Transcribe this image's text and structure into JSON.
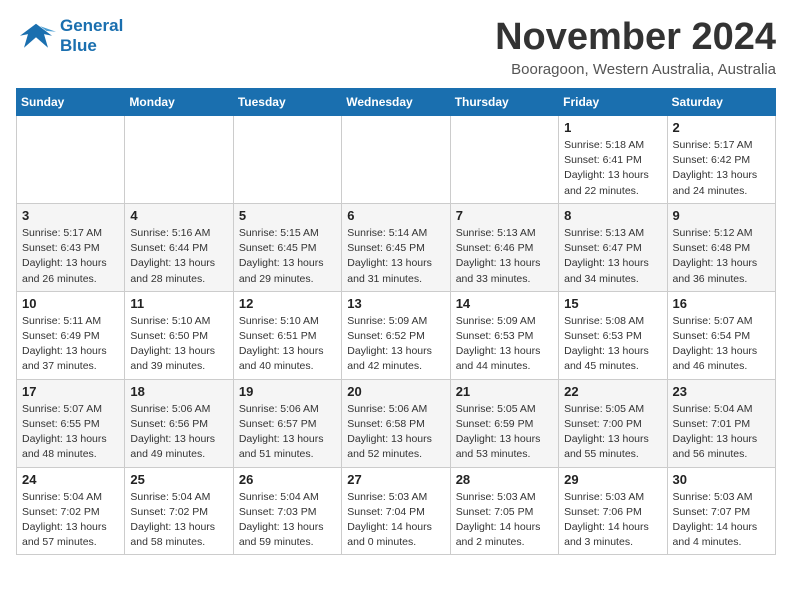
{
  "header": {
    "logo_line1": "General",
    "logo_line2": "Blue",
    "month": "November 2024",
    "location": "Booragoon, Western Australia, Australia"
  },
  "weekdays": [
    "Sunday",
    "Monday",
    "Tuesday",
    "Wednesday",
    "Thursday",
    "Friday",
    "Saturday"
  ],
  "weeks": [
    [
      {
        "day": "",
        "info": ""
      },
      {
        "day": "",
        "info": ""
      },
      {
        "day": "",
        "info": ""
      },
      {
        "day": "",
        "info": ""
      },
      {
        "day": "",
        "info": ""
      },
      {
        "day": "1",
        "info": "Sunrise: 5:18 AM\nSunset: 6:41 PM\nDaylight: 13 hours\nand 22 minutes."
      },
      {
        "day": "2",
        "info": "Sunrise: 5:17 AM\nSunset: 6:42 PM\nDaylight: 13 hours\nand 24 minutes."
      }
    ],
    [
      {
        "day": "3",
        "info": "Sunrise: 5:17 AM\nSunset: 6:43 PM\nDaylight: 13 hours\nand 26 minutes."
      },
      {
        "day": "4",
        "info": "Sunrise: 5:16 AM\nSunset: 6:44 PM\nDaylight: 13 hours\nand 28 minutes."
      },
      {
        "day": "5",
        "info": "Sunrise: 5:15 AM\nSunset: 6:45 PM\nDaylight: 13 hours\nand 29 minutes."
      },
      {
        "day": "6",
        "info": "Sunrise: 5:14 AM\nSunset: 6:45 PM\nDaylight: 13 hours\nand 31 minutes."
      },
      {
        "day": "7",
        "info": "Sunrise: 5:13 AM\nSunset: 6:46 PM\nDaylight: 13 hours\nand 33 minutes."
      },
      {
        "day": "8",
        "info": "Sunrise: 5:13 AM\nSunset: 6:47 PM\nDaylight: 13 hours\nand 34 minutes."
      },
      {
        "day": "9",
        "info": "Sunrise: 5:12 AM\nSunset: 6:48 PM\nDaylight: 13 hours\nand 36 minutes."
      }
    ],
    [
      {
        "day": "10",
        "info": "Sunrise: 5:11 AM\nSunset: 6:49 PM\nDaylight: 13 hours\nand 37 minutes."
      },
      {
        "day": "11",
        "info": "Sunrise: 5:10 AM\nSunset: 6:50 PM\nDaylight: 13 hours\nand 39 minutes."
      },
      {
        "day": "12",
        "info": "Sunrise: 5:10 AM\nSunset: 6:51 PM\nDaylight: 13 hours\nand 40 minutes."
      },
      {
        "day": "13",
        "info": "Sunrise: 5:09 AM\nSunset: 6:52 PM\nDaylight: 13 hours\nand 42 minutes."
      },
      {
        "day": "14",
        "info": "Sunrise: 5:09 AM\nSunset: 6:53 PM\nDaylight: 13 hours\nand 44 minutes."
      },
      {
        "day": "15",
        "info": "Sunrise: 5:08 AM\nSunset: 6:53 PM\nDaylight: 13 hours\nand 45 minutes."
      },
      {
        "day": "16",
        "info": "Sunrise: 5:07 AM\nSunset: 6:54 PM\nDaylight: 13 hours\nand 46 minutes."
      }
    ],
    [
      {
        "day": "17",
        "info": "Sunrise: 5:07 AM\nSunset: 6:55 PM\nDaylight: 13 hours\nand 48 minutes."
      },
      {
        "day": "18",
        "info": "Sunrise: 5:06 AM\nSunset: 6:56 PM\nDaylight: 13 hours\nand 49 minutes."
      },
      {
        "day": "19",
        "info": "Sunrise: 5:06 AM\nSunset: 6:57 PM\nDaylight: 13 hours\nand 51 minutes."
      },
      {
        "day": "20",
        "info": "Sunrise: 5:06 AM\nSunset: 6:58 PM\nDaylight: 13 hours\nand 52 minutes."
      },
      {
        "day": "21",
        "info": "Sunrise: 5:05 AM\nSunset: 6:59 PM\nDaylight: 13 hours\nand 53 minutes."
      },
      {
        "day": "22",
        "info": "Sunrise: 5:05 AM\nSunset: 7:00 PM\nDaylight: 13 hours\nand 55 minutes."
      },
      {
        "day": "23",
        "info": "Sunrise: 5:04 AM\nSunset: 7:01 PM\nDaylight: 13 hours\nand 56 minutes."
      }
    ],
    [
      {
        "day": "24",
        "info": "Sunrise: 5:04 AM\nSunset: 7:02 PM\nDaylight: 13 hours\nand 57 minutes."
      },
      {
        "day": "25",
        "info": "Sunrise: 5:04 AM\nSunset: 7:02 PM\nDaylight: 13 hours\nand 58 minutes."
      },
      {
        "day": "26",
        "info": "Sunrise: 5:04 AM\nSunset: 7:03 PM\nDaylight: 13 hours\nand 59 minutes."
      },
      {
        "day": "27",
        "info": "Sunrise: 5:03 AM\nSunset: 7:04 PM\nDaylight: 14 hours\nand 0 minutes."
      },
      {
        "day": "28",
        "info": "Sunrise: 5:03 AM\nSunset: 7:05 PM\nDaylight: 14 hours\nand 2 minutes."
      },
      {
        "day": "29",
        "info": "Sunrise: 5:03 AM\nSunset: 7:06 PM\nDaylight: 14 hours\nand 3 minutes."
      },
      {
        "day": "30",
        "info": "Sunrise: 5:03 AM\nSunset: 7:07 PM\nDaylight: 14 hours\nand 4 minutes."
      }
    ]
  ]
}
